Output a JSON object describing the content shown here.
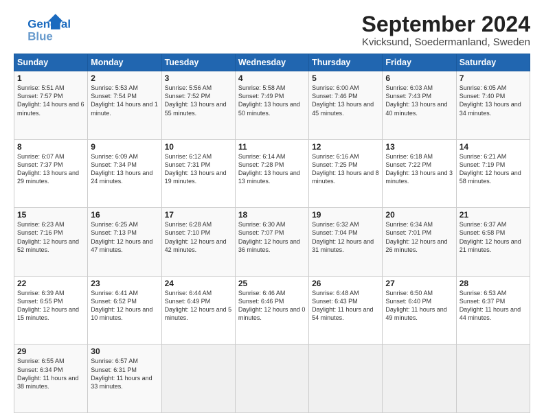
{
  "header": {
    "logo_line1": "General",
    "logo_line2": "Blue",
    "title": "September 2024",
    "subtitle": "Kvicksund, Soedermanland, Sweden"
  },
  "weekdays": [
    "Sunday",
    "Monday",
    "Tuesday",
    "Wednesday",
    "Thursday",
    "Friday",
    "Saturday"
  ],
  "weeks": [
    [
      {
        "day": "1",
        "sunrise": "5:51 AM",
        "sunset": "7:57 PM",
        "daylight": "14 hours and 6 minutes."
      },
      {
        "day": "2",
        "sunrise": "5:53 AM",
        "sunset": "7:54 PM",
        "daylight": "14 hours and 1 minute."
      },
      {
        "day": "3",
        "sunrise": "5:56 AM",
        "sunset": "7:52 PM",
        "daylight": "13 hours and 55 minutes."
      },
      {
        "day": "4",
        "sunrise": "5:58 AM",
        "sunset": "7:49 PM",
        "daylight": "13 hours and 50 minutes."
      },
      {
        "day": "5",
        "sunrise": "6:00 AM",
        "sunset": "7:46 PM",
        "daylight": "13 hours and 45 minutes."
      },
      {
        "day": "6",
        "sunrise": "6:03 AM",
        "sunset": "7:43 PM",
        "daylight": "13 hours and 40 minutes."
      },
      {
        "day": "7",
        "sunrise": "6:05 AM",
        "sunset": "7:40 PM",
        "daylight": "13 hours and 34 minutes."
      }
    ],
    [
      {
        "day": "8",
        "sunrise": "6:07 AM",
        "sunset": "7:37 PM",
        "daylight": "13 hours and 29 minutes."
      },
      {
        "day": "9",
        "sunrise": "6:09 AM",
        "sunset": "7:34 PM",
        "daylight": "13 hours and 24 minutes."
      },
      {
        "day": "10",
        "sunrise": "6:12 AM",
        "sunset": "7:31 PM",
        "daylight": "13 hours and 19 minutes."
      },
      {
        "day": "11",
        "sunrise": "6:14 AM",
        "sunset": "7:28 PM",
        "daylight": "13 hours and 13 minutes."
      },
      {
        "day": "12",
        "sunrise": "6:16 AM",
        "sunset": "7:25 PM",
        "daylight": "13 hours and 8 minutes."
      },
      {
        "day": "13",
        "sunrise": "6:18 AM",
        "sunset": "7:22 PM",
        "daylight": "13 hours and 3 minutes."
      },
      {
        "day": "14",
        "sunrise": "6:21 AM",
        "sunset": "7:19 PM",
        "daylight": "12 hours and 58 minutes."
      }
    ],
    [
      {
        "day": "15",
        "sunrise": "6:23 AM",
        "sunset": "7:16 PM",
        "daylight": "12 hours and 52 minutes."
      },
      {
        "day": "16",
        "sunrise": "6:25 AM",
        "sunset": "7:13 PM",
        "daylight": "12 hours and 47 minutes."
      },
      {
        "day": "17",
        "sunrise": "6:28 AM",
        "sunset": "7:10 PM",
        "daylight": "12 hours and 42 minutes."
      },
      {
        "day": "18",
        "sunrise": "6:30 AM",
        "sunset": "7:07 PM",
        "daylight": "12 hours and 36 minutes."
      },
      {
        "day": "19",
        "sunrise": "6:32 AM",
        "sunset": "7:04 PM",
        "daylight": "12 hours and 31 minutes."
      },
      {
        "day": "20",
        "sunrise": "6:34 AM",
        "sunset": "7:01 PM",
        "daylight": "12 hours and 26 minutes."
      },
      {
        "day": "21",
        "sunrise": "6:37 AM",
        "sunset": "6:58 PM",
        "daylight": "12 hours and 21 minutes."
      }
    ],
    [
      {
        "day": "22",
        "sunrise": "6:39 AM",
        "sunset": "6:55 PM",
        "daylight": "12 hours and 15 minutes."
      },
      {
        "day": "23",
        "sunrise": "6:41 AM",
        "sunset": "6:52 PM",
        "daylight": "12 hours and 10 minutes."
      },
      {
        "day": "24",
        "sunrise": "6:44 AM",
        "sunset": "6:49 PM",
        "daylight": "12 hours and 5 minutes."
      },
      {
        "day": "25",
        "sunrise": "6:46 AM",
        "sunset": "6:46 PM",
        "daylight": "12 hours and 0 minutes."
      },
      {
        "day": "26",
        "sunrise": "6:48 AM",
        "sunset": "6:43 PM",
        "daylight": "11 hours and 54 minutes."
      },
      {
        "day": "27",
        "sunrise": "6:50 AM",
        "sunset": "6:40 PM",
        "daylight": "11 hours and 49 minutes."
      },
      {
        "day": "28",
        "sunrise": "6:53 AM",
        "sunset": "6:37 PM",
        "daylight": "11 hours and 44 minutes."
      }
    ],
    [
      {
        "day": "29",
        "sunrise": "6:55 AM",
        "sunset": "6:34 PM",
        "daylight": "11 hours and 38 minutes."
      },
      {
        "day": "30",
        "sunrise": "6:57 AM",
        "sunset": "6:31 PM",
        "daylight": "11 hours and 33 minutes."
      },
      null,
      null,
      null,
      null,
      null
    ]
  ]
}
